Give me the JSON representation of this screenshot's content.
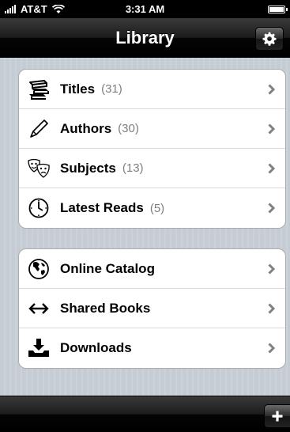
{
  "status_bar": {
    "carrier": "AT&T",
    "time": "3:31 AM",
    "battery_level": 1.0
  },
  "nav": {
    "title": "Library",
    "settings_icon": "gear-icon"
  },
  "library_groups": [
    {
      "items": [
        {
          "label": "Titles",
          "count": "(31)",
          "icon": "books-icon"
        },
        {
          "label": "Authors",
          "count": "(30)",
          "icon": "pen-icon"
        },
        {
          "label": "Subjects",
          "count": "(13)",
          "icon": "theater-masks-icon"
        },
        {
          "label": "Latest Reads",
          "count": "(5)",
          "icon": "clock-icon"
        }
      ]
    },
    {
      "items": [
        {
          "label": "Online Catalog",
          "icon": "globe-icon"
        },
        {
          "label": "Shared Books",
          "icon": "left-right-arrow-icon"
        },
        {
          "label": "Downloads",
          "icon": "download-tray-icon"
        }
      ]
    }
  ],
  "toolbar": {
    "add_icon": "plus-icon"
  },
  "colors": {
    "background": "#c5ccd4",
    "count_text": "#7f7f7f",
    "chevron": "#808080"
  }
}
